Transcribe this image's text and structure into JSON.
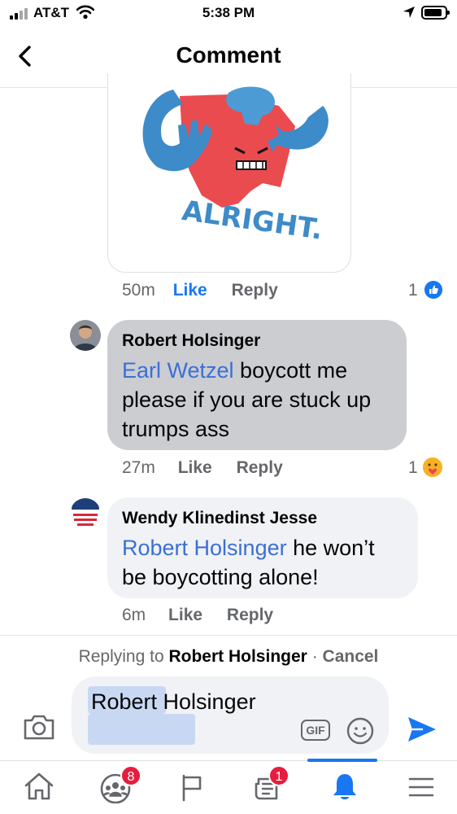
{
  "status_bar": {
    "carrier": "AT&T",
    "time": "5:38 PM"
  },
  "header": {
    "title": "Comment"
  },
  "image_post": {
    "caption": "ALRIGHT.",
    "time": "50m",
    "like_label": "Like",
    "reply_label": "Reply",
    "reaction_count": "1"
  },
  "comments": [
    {
      "author": "Robert Holsinger",
      "mention": "Earl Wetzel",
      "text": " boycott me please if you are stuck up trumps ass",
      "time": "27m",
      "like_label": "Like",
      "reply_label": "Reply",
      "reaction_count": "1"
    },
    {
      "author": "Wendy Klinedinst Jesse",
      "mention": "Robert Holsinger",
      "text": "  he won’t be boycotting alone!",
      "time": "6m",
      "like_label": "Like",
      "reply_label": "Reply"
    }
  ],
  "reply_bar": {
    "prefix": "Replying to",
    "target": "Robert Holsinger",
    "separator": "·",
    "cancel": "Cancel",
    "input_value": "Robert Holsinger",
    "gif_label": "GIF"
  },
  "tab_bar": {
    "groups_badge": "8",
    "news_badge": "1"
  },
  "colors": {
    "accent": "#1877f2",
    "mention": "#3b6fd6",
    "badge": "#e41e3f",
    "bubble_selected": "#cbcdd1",
    "bubble": "#f0f2f5"
  }
}
